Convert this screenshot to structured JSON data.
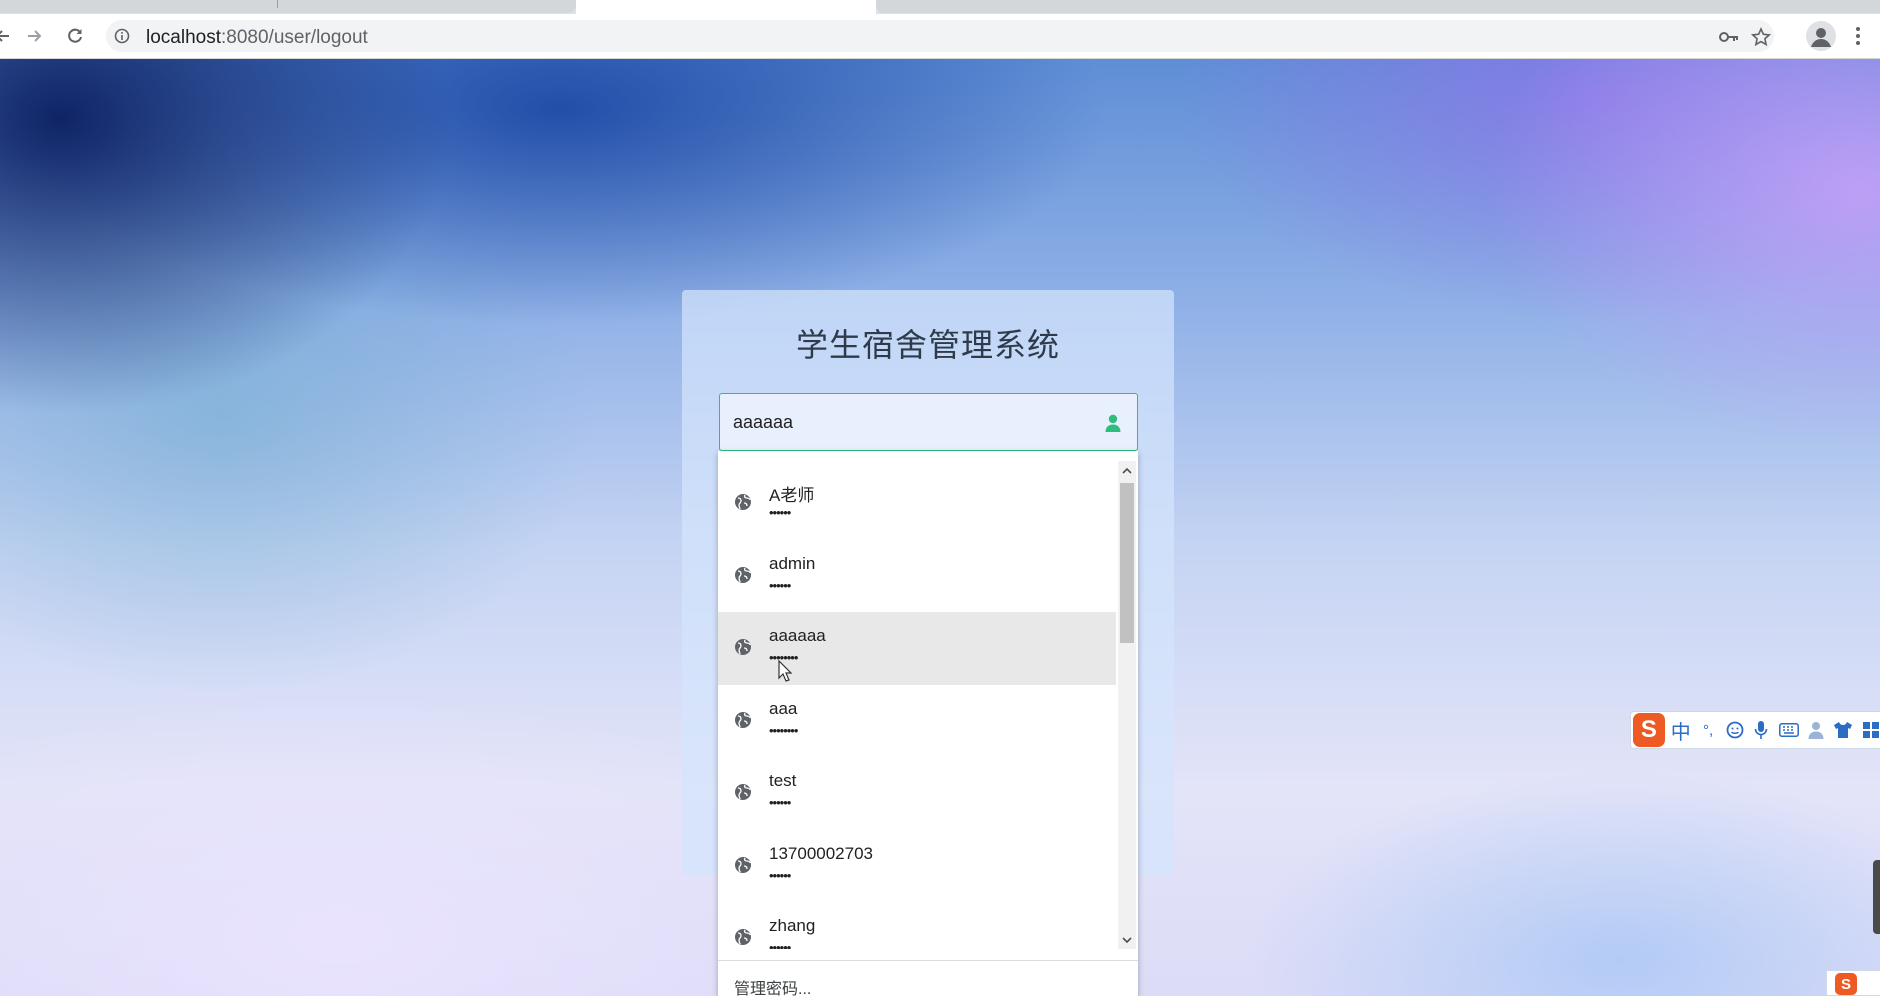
{
  "browser": {
    "url_host": "localhost",
    "url_path": ":8080/user/logout",
    "nav_icons": [
      "back-icon",
      "forward-icon",
      "reload-icon",
      "info-icon"
    ],
    "toolbar_icons": [
      "key-icon",
      "star-icon",
      "profile-icon",
      "menu-icon"
    ]
  },
  "login": {
    "title": "学生宿舍管理系统",
    "username_value": "aaaaaa",
    "username_icon": "user-icon",
    "accent_color": "#2ebd7c"
  },
  "autofill": {
    "items": [
      {
        "name": "A老师",
        "password_mask": "••••••"
      },
      {
        "name": "admin",
        "password_mask": "••••••"
      },
      {
        "name": "aaaaaa",
        "password_mask": "••••••••"
      },
      {
        "name": "aaa",
        "password_mask": "••••••••"
      },
      {
        "name": "test",
        "password_mask": "••••••"
      },
      {
        "name": "13700002703",
        "password_mask": "••••••"
      },
      {
        "name": "zhang",
        "password_mask": "••••••"
      }
    ],
    "hovered_index": 2,
    "manage_label": "管理密码..."
  },
  "ime": {
    "logo": "S",
    "mode_label": "中",
    "punct_label": "°,",
    "icons": [
      "emoji-icon",
      "microphone-icon",
      "keyboard-icon",
      "user-icon",
      "skin-icon",
      "grid-icon"
    ]
  }
}
